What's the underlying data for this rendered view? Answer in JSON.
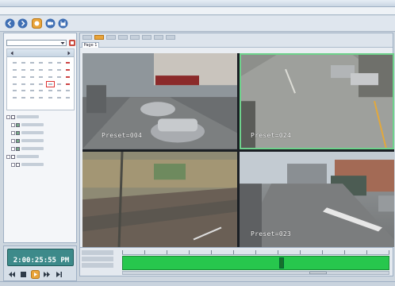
{
  "window": {
    "title": ""
  },
  "menu": [
    "",
    "",
    "",
    "",
    "",
    ""
  ],
  "toolbar": {
    "buttons": [
      {
        "icon": "back-icon"
      },
      {
        "icon": "forward-icon"
      },
      {
        "icon": "record-icon"
      },
      {
        "icon": "camera-icon"
      },
      {
        "icon": "save-icon"
      }
    ]
  },
  "left_panel": {
    "title": "",
    "site_selector": {
      "value": ""
    },
    "calendar": {
      "title": ""
    },
    "tree": {
      "items": [
        {
          "label": "",
          "checked": false,
          "level": 0
        },
        {
          "label": "",
          "checked": true,
          "level": 1
        },
        {
          "label": "",
          "checked": true,
          "level": 1
        },
        {
          "label": "",
          "checked": true,
          "level": 1
        },
        {
          "label": "",
          "checked": true,
          "level": 1
        },
        {
          "label": "",
          "checked": false,
          "level": 0
        },
        {
          "label": "",
          "checked": false,
          "level": 1
        }
      ]
    }
  },
  "main": {
    "page_tab": "Page 1",
    "cameras": [
      {
        "overlay_top": "",
        "overlay_bottom": "Preset=004",
        "active": false
      },
      {
        "overlay_top": "",
        "overlay_bottom": "Preset=024",
        "active": true
      },
      {
        "overlay_top": "",
        "overlay_bottom": "",
        "active": false
      },
      {
        "overlay_top": "",
        "overlay_bottom": "Preset=023",
        "active": false
      }
    ]
  },
  "playback": {
    "date": "",
    "time": "2:00:25:55 PM"
  },
  "status": {
    "text": ""
  },
  "colors": {
    "timeline_green": "#27c74d",
    "active_border": "#6fd28c",
    "record_orange": "#e9a43a",
    "clock_bg": "#3d8a8a"
  }
}
